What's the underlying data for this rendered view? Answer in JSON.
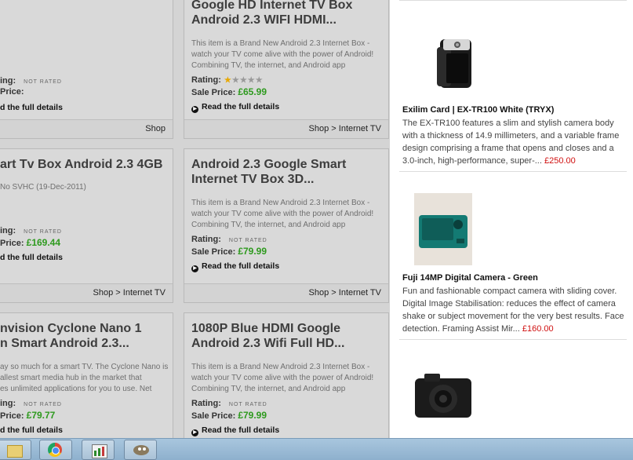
{
  "left_products": [
    {
      "title": "Google HD Internet TV Box\nAndroid 2.3 WIFI HDMI...",
      "desc": "This item is a Brand New Android 2.3 Internet Box - watch your TV come alive with the power of Android! Combining TV, the internet, and Android app",
      "rating_label": "Rating:",
      "rating": "1 of 5",
      "sale_label": "Sale Price:",
      "price": "£65.99",
      "read_more": "Read the full details",
      "breadcrumb": "Shop > Internet TV"
    },
    {
      "title": "art Tv Box Android 2.3 4GB",
      "date": "No SVHC (19-Dec-2011)",
      "rating_label": "ing:",
      "not_rated": "NOT RATED",
      "sale_label": "Price:",
      "price": "£169.44",
      "read_more": "d the full details",
      "breadcrumb": "Shop > Internet TV"
    },
    {
      "title": "Android 2.3 Google Smart\nInternet TV Box 3D...",
      "desc": "This item is a Brand New Android 2.3 Internet Box - watch your TV come alive with the power of Android! Combining TV, the internet, and Android app",
      "rating_label": "Rating:",
      "not_rated": "NOT RATED",
      "sale_label": "Sale Price:",
      "price": "£79.99",
      "read_more": "Read the full details",
      "breadcrumb": "Shop > Internet TV"
    },
    {
      "title": "nvision Cyclone Nano 1\nn Smart Android 2.3...",
      "desc": "ay so much for a smart TV. The Cyclone Nano is\nallest smart media hub in the market that\nes unlimited applications for you to use. Net",
      "rating_label": "ing:",
      "not_rated": "NOT RATED",
      "sale_label": "Price:",
      "price": "£79.77",
      "read_more": "d the full details"
    },
    {
      "title": "1080P Blue HDMI Google\nAndroid 2.3 Wifi Full HD...",
      "desc": "This item is a Brand New Android 2.3 Internet Box - watch your TV come alive with the power of Android! Combining TV, the internet, and Android app",
      "rating_label": "Rating:",
      "not_rated": "NOT RATED",
      "sale_label": "Sale Price:",
      "price": "£79.99",
      "read_more": "Read the full details"
    }
  ],
  "top_left_card": {
    "rating_label": "ing:",
    "not_rated": "NOT RATED",
    "sale_label": "Price:",
    "read_more": "d the full details",
    "breadcrumb": "Shop"
  },
  "right_items": [
    {
      "title": "Exilim Card | EX-TR100 White (TRYX)",
      "desc": "The EX-TR100 features a slim and stylish camera body with a thickness of 14.9 millimeters, and a variable frame design comprising a frame that opens and closes and a 3.0-inch, high-performance, super-...",
      "price": "£250.00",
      "image": "camera-white-exilim"
    },
    {
      "title": "Fuji 14MP Digital Camera - Green",
      "desc": "Fun and fashionable compact camera with sliding cover. Digital Image Stabilisation: reduces the effect of camera shake or subject movement for the very best results. Face detection. Framing Assist Mir...",
      "price": "£160.00",
      "image": "camera-green-fuji"
    },
    {
      "title": "",
      "desc": "",
      "price": "",
      "image": "camera-black-compact"
    }
  ],
  "taskbar": {
    "buttons": [
      "file-explorer-icon",
      "chrome-icon",
      "chart-app-icon",
      "gimp-icon"
    ]
  },
  "colors": {
    "price_green": "#2e9a1e",
    "price_red": "#d01010",
    "grey_panel": "#d4d4d4"
  }
}
